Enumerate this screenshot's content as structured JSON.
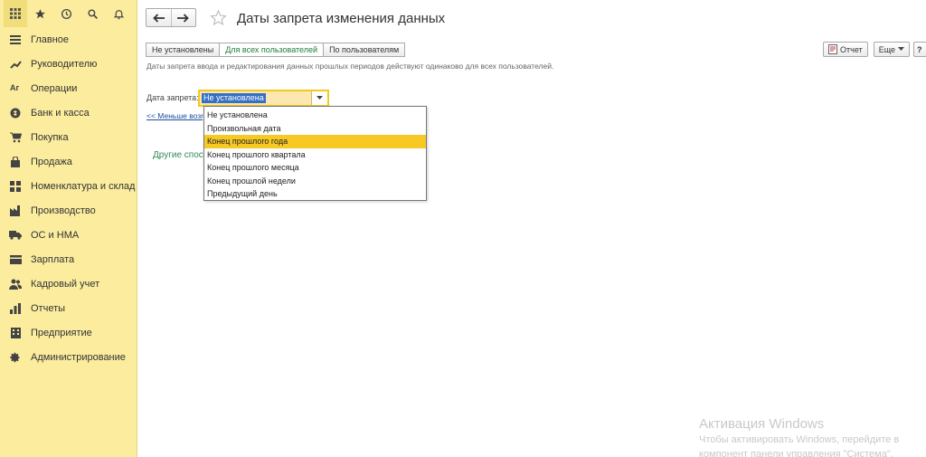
{
  "sidebar": {
    "top_icons": [
      "grid-icon",
      "star-icon",
      "history-icon",
      "search-icon",
      "bell-icon"
    ],
    "items": [
      {
        "label": "Главное",
        "icon": "menu-icon"
      },
      {
        "label": "Руководителю",
        "icon": "chart-line-icon"
      },
      {
        "label": "Операции",
        "icon": "operations-icon"
      },
      {
        "label": "Банк и касса",
        "icon": "coin-icon"
      },
      {
        "label": "Покупка",
        "icon": "cart-icon"
      },
      {
        "label": "Продажа",
        "icon": "bag-icon"
      },
      {
        "label": "Номенклатура и склад",
        "icon": "warehouse-icon"
      },
      {
        "label": "Производство",
        "icon": "factory-icon"
      },
      {
        "label": "ОС и НМА",
        "icon": "truck-icon"
      },
      {
        "label": "Зарплата",
        "icon": "wallet-icon"
      },
      {
        "label": "Кадровый учет",
        "icon": "people-icon"
      },
      {
        "label": "Отчеты",
        "icon": "report-icon"
      },
      {
        "label": "Предприятие",
        "icon": "building-icon"
      },
      {
        "label": "Администрирование",
        "icon": "gear-icon"
      }
    ]
  },
  "header": {
    "title": "Даты запрета изменения данных"
  },
  "tabs": [
    {
      "label": "Не установлены"
    },
    {
      "label": "Для всех пользователей",
      "active": true
    },
    {
      "label": "По пользователям"
    }
  ],
  "toolbar": {
    "report_label": "Отчет",
    "more_label": "Еще",
    "help_label": "?"
  },
  "hint": "Даты запрета ввода и редактирования данных прошлых периодов действуют одинаково для всех пользователей.",
  "date_field": {
    "label": "Дата запрета:",
    "value": "Не установлена"
  },
  "less_link": "<< Меньше возможностей",
  "other_section": "Другие способы",
  "dropdown": {
    "options": [
      "Не установлена",
      "Произвольная дата",
      "Конец прошлого года",
      "Конец прошлого квартала",
      "Конец прошлого месяца",
      "Конец прошлой недели",
      "Предыдущий день"
    ],
    "highlighted_index": 2
  },
  "watermark": {
    "title": "Активация Windows",
    "line1": "Чтобы активировать Windows, перейдите в",
    "line2": "компонент панели управления \"Система\"."
  },
  "colors": {
    "sidebar_bg": "#fbec9e",
    "highlight": "#f7c925",
    "active_tab_text": "#1f7d3a",
    "link": "#1b4f9c",
    "selection": "#3670c4"
  }
}
